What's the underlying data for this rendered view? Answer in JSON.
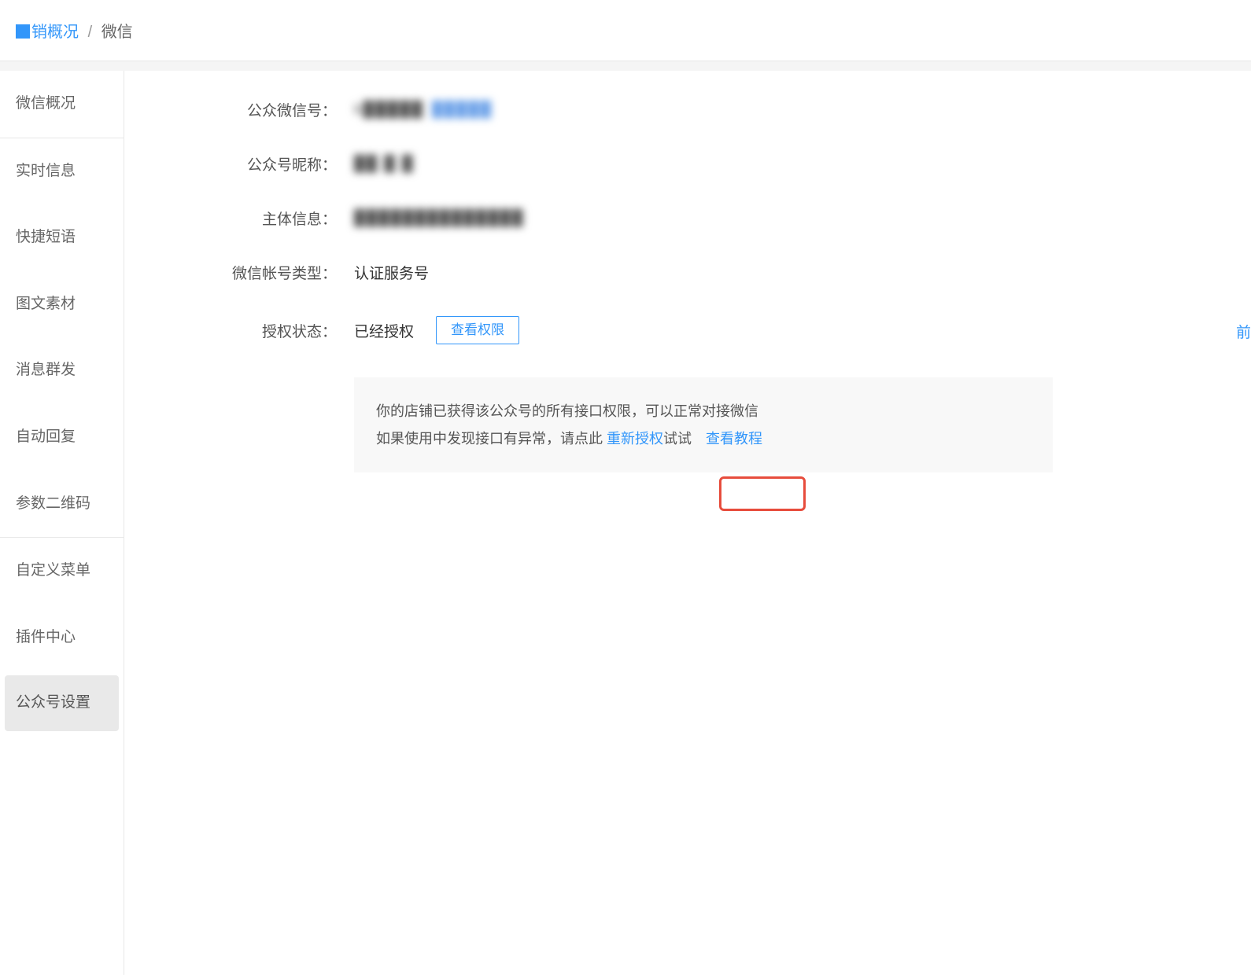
{
  "breadcrumb": {
    "root": "销概况",
    "separator": "/",
    "current": "微信"
  },
  "sidebar": {
    "groups": [
      {
        "items": [
          {
            "label": "微信概况"
          }
        ]
      },
      {
        "items": [
          {
            "label": "实时信息"
          },
          {
            "label": "快捷短语"
          },
          {
            "label": "图文素材"
          },
          {
            "label": "消息群发"
          },
          {
            "label": "自动回复"
          },
          {
            "label": "参数二维码"
          }
        ]
      },
      {
        "items": [
          {
            "label": "自定义菜单"
          },
          {
            "label": "插件中心"
          },
          {
            "label": "公众号设置",
            "active": true
          }
        ]
      }
    ]
  },
  "form": {
    "wechat_id_label": "公众微信号：",
    "wechat_id_value": "k█████",
    "wechat_id_value2": "█████",
    "nickname_label": "公众号昵称：",
    "nickname_value": "██ █ █",
    "subject_label": "主体信息：",
    "subject_value": "██████████████",
    "account_type_label": "微信帐号类型：",
    "account_type_value": "认证服务号",
    "auth_status_label": "授权状态：",
    "auth_status_value": "已经授权",
    "view_perm_btn": "查看权限",
    "right_link": "前"
  },
  "infobox": {
    "line1": "你的店铺已获得该公众号的所有接口权限，可以正常对接微信",
    "line2a": "如果使用中发现接口有异常，请点此 ",
    "reauth_link": "重新授权",
    "line2b": "试试",
    "tutorial_link": "查看教程"
  }
}
